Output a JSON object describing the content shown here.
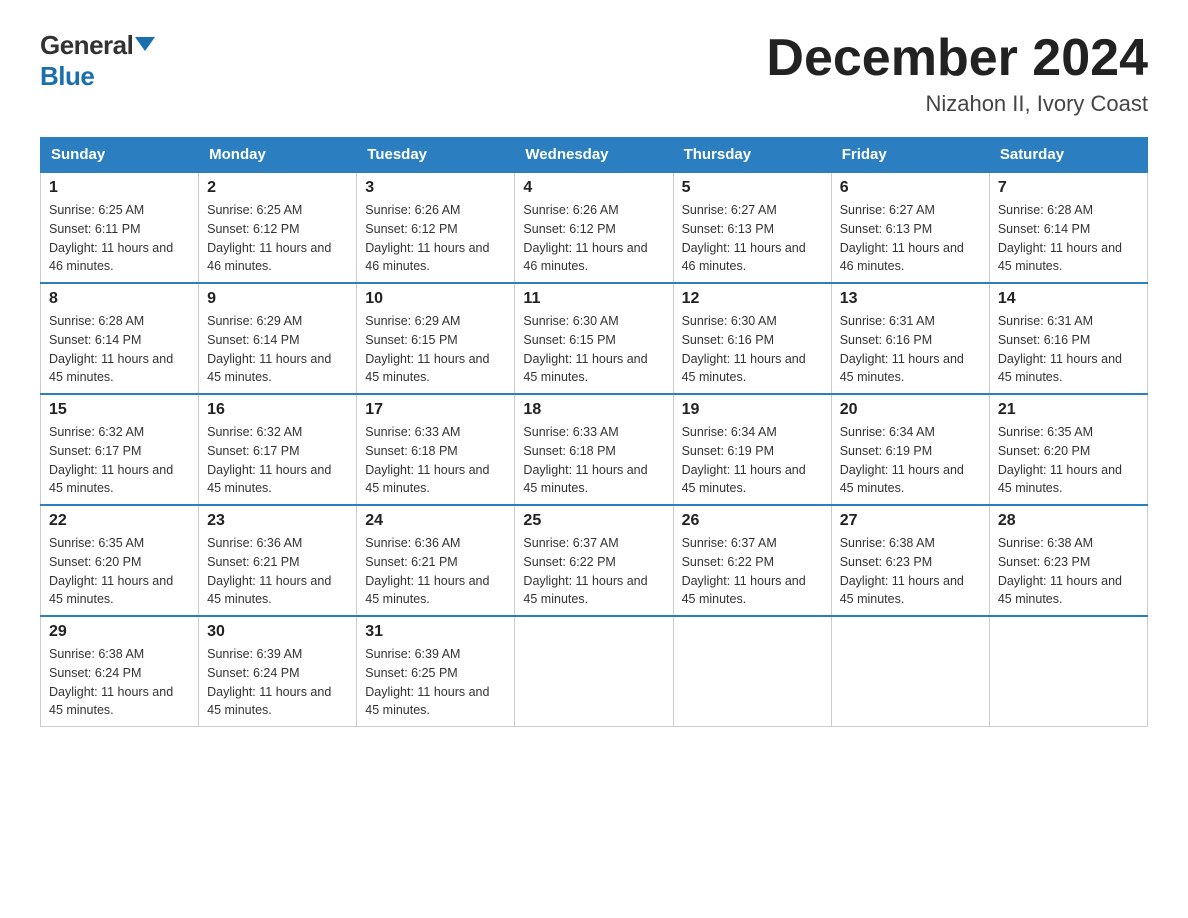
{
  "logo": {
    "general": "General",
    "blue": "Blue"
  },
  "title": "December 2024",
  "subtitle": "Nizahon II, Ivory Coast",
  "days": [
    "Sunday",
    "Monday",
    "Tuesday",
    "Wednesday",
    "Thursday",
    "Friday",
    "Saturday"
  ],
  "weeks": [
    [
      {
        "num": "1",
        "sunrise": "6:25 AM",
        "sunset": "6:11 PM",
        "daylight": "11 hours and 46 minutes."
      },
      {
        "num": "2",
        "sunrise": "6:25 AM",
        "sunset": "6:12 PM",
        "daylight": "11 hours and 46 minutes."
      },
      {
        "num": "3",
        "sunrise": "6:26 AM",
        "sunset": "6:12 PM",
        "daylight": "11 hours and 46 minutes."
      },
      {
        "num": "4",
        "sunrise": "6:26 AM",
        "sunset": "6:12 PM",
        "daylight": "11 hours and 46 minutes."
      },
      {
        "num": "5",
        "sunrise": "6:27 AM",
        "sunset": "6:13 PM",
        "daylight": "11 hours and 46 minutes."
      },
      {
        "num": "6",
        "sunrise": "6:27 AM",
        "sunset": "6:13 PM",
        "daylight": "11 hours and 46 minutes."
      },
      {
        "num": "7",
        "sunrise": "6:28 AM",
        "sunset": "6:14 PM",
        "daylight": "11 hours and 45 minutes."
      }
    ],
    [
      {
        "num": "8",
        "sunrise": "6:28 AM",
        "sunset": "6:14 PM",
        "daylight": "11 hours and 45 minutes."
      },
      {
        "num": "9",
        "sunrise": "6:29 AM",
        "sunset": "6:14 PM",
        "daylight": "11 hours and 45 minutes."
      },
      {
        "num": "10",
        "sunrise": "6:29 AM",
        "sunset": "6:15 PM",
        "daylight": "11 hours and 45 minutes."
      },
      {
        "num": "11",
        "sunrise": "6:30 AM",
        "sunset": "6:15 PM",
        "daylight": "11 hours and 45 minutes."
      },
      {
        "num": "12",
        "sunrise": "6:30 AM",
        "sunset": "6:16 PM",
        "daylight": "11 hours and 45 minutes."
      },
      {
        "num": "13",
        "sunrise": "6:31 AM",
        "sunset": "6:16 PM",
        "daylight": "11 hours and 45 minutes."
      },
      {
        "num": "14",
        "sunrise": "6:31 AM",
        "sunset": "6:16 PM",
        "daylight": "11 hours and 45 minutes."
      }
    ],
    [
      {
        "num": "15",
        "sunrise": "6:32 AM",
        "sunset": "6:17 PM",
        "daylight": "11 hours and 45 minutes."
      },
      {
        "num": "16",
        "sunrise": "6:32 AM",
        "sunset": "6:17 PM",
        "daylight": "11 hours and 45 minutes."
      },
      {
        "num": "17",
        "sunrise": "6:33 AM",
        "sunset": "6:18 PM",
        "daylight": "11 hours and 45 minutes."
      },
      {
        "num": "18",
        "sunrise": "6:33 AM",
        "sunset": "6:18 PM",
        "daylight": "11 hours and 45 minutes."
      },
      {
        "num": "19",
        "sunrise": "6:34 AM",
        "sunset": "6:19 PM",
        "daylight": "11 hours and 45 minutes."
      },
      {
        "num": "20",
        "sunrise": "6:34 AM",
        "sunset": "6:19 PM",
        "daylight": "11 hours and 45 minutes."
      },
      {
        "num": "21",
        "sunrise": "6:35 AM",
        "sunset": "6:20 PM",
        "daylight": "11 hours and 45 minutes."
      }
    ],
    [
      {
        "num": "22",
        "sunrise": "6:35 AM",
        "sunset": "6:20 PM",
        "daylight": "11 hours and 45 minutes."
      },
      {
        "num": "23",
        "sunrise": "6:36 AM",
        "sunset": "6:21 PM",
        "daylight": "11 hours and 45 minutes."
      },
      {
        "num": "24",
        "sunrise": "6:36 AM",
        "sunset": "6:21 PM",
        "daylight": "11 hours and 45 minutes."
      },
      {
        "num": "25",
        "sunrise": "6:37 AM",
        "sunset": "6:22 PM",
        "daylight": "11 hours and 45 minutes."
      },
      {
        "num": "26",
        "sunrise": "6:37 AM",
        "sunset": "6:22 PM",
        "daylight": "11 hours and 45 minutes."
      },
      {
        "num": "27",
        "sunrise": "6:38 AM",
        "sunset": "6:23 PM",
        "daylight": "11 hours and 45 minutes."
      },
      {
        "num": "28",
        "sunrise": "6:38 AM",
        "sunset": "6:23 PM",
        "daylight": "11 hours and 45 minutes."
      }
    ],
    [
      {
        "num": "29",
        "sunrise": "6:38 AM",
        "sunset": "6:24 PM",
        "daylight": "11 hours and 45 minutes."
      },
      {
        "num": "30",
        "sunrise": "6:39 AM",
        "sunset": "6:24 PM",
        "daylight": "11 hours and 45 minutes."
      },
      {
        "num": "31",
        "sunrise": "6:39 AM",
        "sunset": "6:25 PM",
        "daylight": "11 hours and 45 minutes."
      },
      null,
      null,
      null,
      null
    ]
  ]
}
